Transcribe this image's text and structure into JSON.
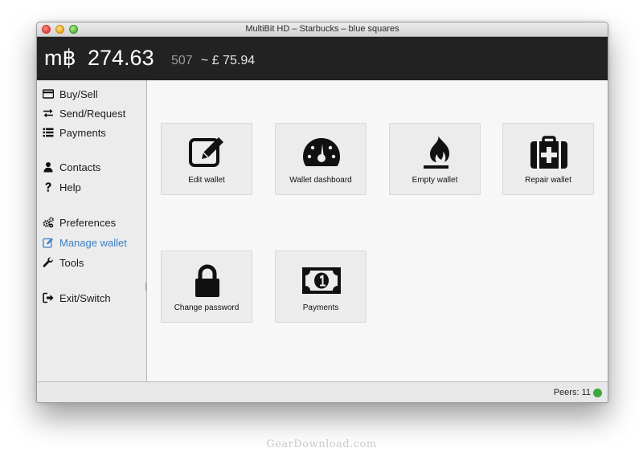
{
  "window": {
    "title": "MultiBit HD – Starbucks – blue squares"
  },
  "header": {
    "balance_symbol": "m฿",
    "balance_main": "274.63",
    "balance_small": "507",
    "balance_fiat": "~ £ 75.94"
  },
  "sidebar": {
    "items": [
      {
        "label": "Buy/Sell",
        "icon": "credit-card-icon",
        "active": false
      },
      {
        "label": "Send/Request",
        "icon": "exchange-arrows-icon",
        "active": false
      },
      {
        "label": "Payments",
        "icon": "list-icon",
        "active": false
      },
      {
        "label": "Contacts",
        "icon": "user-icon",
        "active": false
      },
      {
        "label": "Help",
        "icon": "question-icon",
        "active": false
      },
      {
        "label": "Preferences",
        "icon": "gears-icon",
        "active": false
      },
      {
        "label": "Manage wallet",
        "icon": "edit-icon",
        "active": true
      },
      {
        "label": "Tools",
        "icon": "wrench-icon",
        "active": false
      },
      {
        "label": "Exit/Switch",
        "icon": "sign-out-icon",
        "active": false
      }
    ]
  },
  "tiles": [
    {
      "label": "Edit wallet",
      "icon": "edit-icon"
    },
    {
      "label": "Wallet dashboard",
      "icon": "dashboard-icon"
    },
    {
      "label": "Empty wallet",
      "icon": "fire-icon"
    },
    {
      "label": "Repair wallet",
      "icon": "medkit-icon"
    },
    {
      "label": "Change password",
      "icon": "lock-icon"
    },
    {
      "label": "Payments",
      "icon": "money-icon"
    }
  ],
  "status": {
    "peers_text": "Peers: 11",
    "peer_color": "#3fa73f"
  },
  "colors": {
    "header_bg": "#222222",
    "active_nav": "#3a7fc6"
  },
  "watermark": "GearDownload.com"
}
